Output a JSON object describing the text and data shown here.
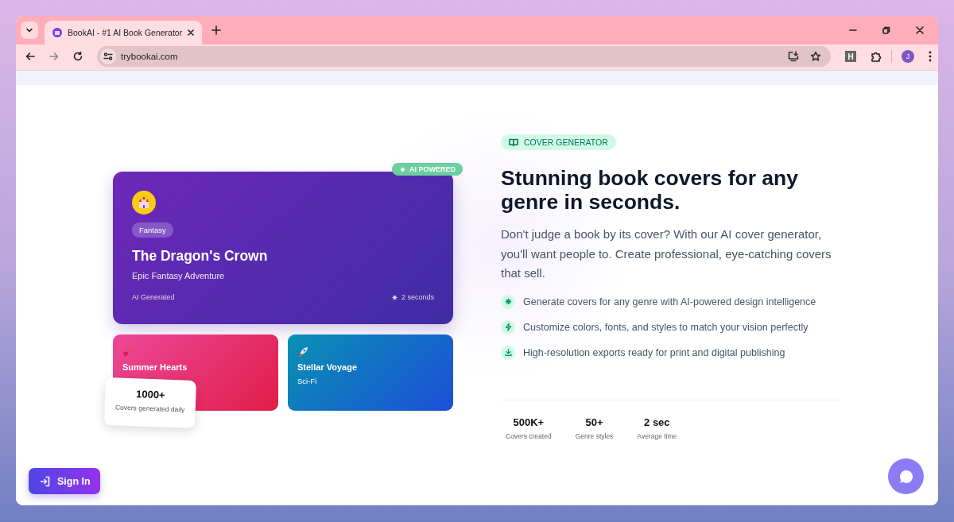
{
  "browser": {
    "tabs": [
      {
        "title": "BookAI - #1 AI Book Generator",
        "selected": true
      }
    ],
    "address": "trybookai.com",
    "extension_label": "H",
    "profile_initial": "J"
  },
  "showcase": {
    "badge": "AI POWERED",
    "main_card": {
      "genre": "Fantasy",
      "title": "The Dragon's Crown",
      "subtitle": "Epic Fantasy Adventure",
      "footer_label": "AI Generated",
      "time": "2 seconds"
    },
    "small_cards": [
      {
        "kind": "romance",
        "title": "Summer Hearts"
      },
      {
        "kind": "scifi",
        "title": "Stellar Voyage",
        "subtitle": "Sci-Fi"
      }
    ],
    "floating_stat": {
      "value": "1000+",
      "label": "Covers generated daily"
    }
  },
  "hero": {
    "badge": "COVER GENERATOR",
    "heading": "Stunning book covers for any genre in seconds.",
    "paragraph": "Don't judge a book by its cover? With our AI cover generator, you'll want people to. Create professional, eye-catching covers that sell.",
    "features": [
      {
        "text": "Generate covers for any genre with AI-powered design intelligence"
      },
      {
        "text": "Customize colors, fonts, and styles to match your vision perfectly"
      },
      {
        "text": "High-resolution exports ready for print and digital publishing"
      }
    ],
    "stats": [
      {
        "value": "500K+",
        "label": "Covers created"
      },
      {
        "value": "50+",
        "label": "Genre styles"
      },
      {
        "value": "2 sec",
        "label": "Average time"
      }
    ]
  },
  "sign_in": "Sign In"
}
